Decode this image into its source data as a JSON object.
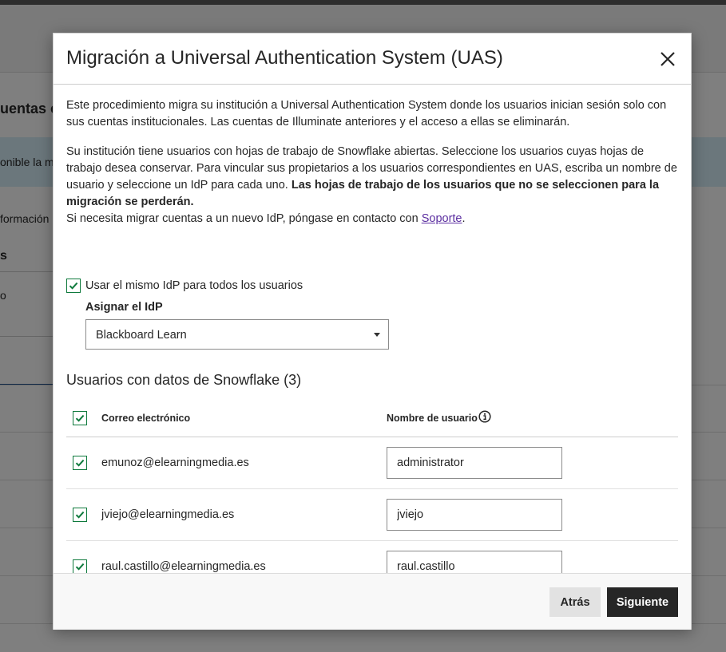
{
  "background": {
    "title_fragment": "uentas c",
    "banner_fragment": "onible la m",
    "info_fragment": "formación",
    "column_fragment": "s",
    "box_fragment": "o"
  },
  "modal": {
    "title": "Migración a Universal Authentication System (UAS)",
    "intro": "Este procedimiento migra su institución a Universal Authentication System donde los usuarios inician sesión solo con sus cuentas institucionales. Las cuentas de Illuminate anteriores y el acceso a ellas se eliminarán.",
    "explain": "Su institución tiene usuarios con hojas de trabajo de Snowflake abiertas. Seleccione los usuarios cuyas hojas de trabajo desea conservar. Para vincular sus propietarios a los usuarios correspondientes en UAS, escriba un nombre de usuario y seleccione un IdP para cada uno. ",
    "warning": "Las hojas de trabajo de los usuarios que no se seleccionen para la migración se perderán.",
    "contact_prefix": "Si necesita migrar cuentas a un nuevo IdP, póngase en contacto con ",
    "contact_link": "Soporte",
    "contact_suffix": ".",
    "same_idp_label": "Usar el mismo IdP para todos los usuarios",
    "same_idp_checked": true,
    "assign_label": "Asignar el IdP",
    "idp_selected": "Blackboard Learn",
    "section_title": "Usuarios con datos de Snowflake (3)",
    "table": {
      "col_email": "Correo electrónico",
      "col_username": "Nombre de usuario",
      "rows": [
        {
          "email": "emunoz@elearningmedia.es",
          "username": "administrator",
          "checked": true
        },
        {
          "email": "jviejo@elearningmedia.es",
          "username": "jviejo",
          "checked": true
        },
        {
          "email": "raul.castillo@elearningmedia.es",
          "username": "raul.castillo",
          "checked": true
        }
      ]
    },
    "buttons": {
      "back": "Atrás",
      "next": "Siguiente"
    }
  },
  "colors": {
    "checkbox": "#0f7a3d",
    "link": "#5b2ea0",
    "primary_button": "#262626",
    "secondary_button": "#e2e2e2"
  }
}
